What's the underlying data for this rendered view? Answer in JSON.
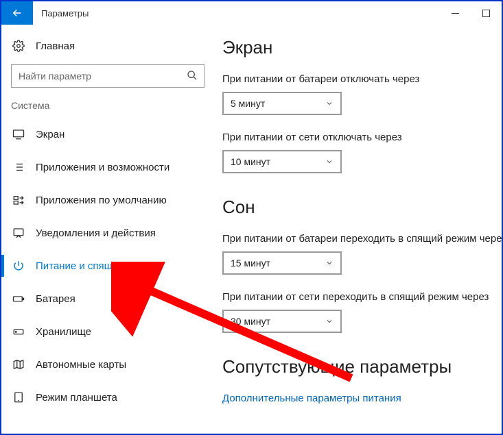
{
  "titlebar": {
    "title": "Параметры"
  },
  "sidebar": {
    "home": "Главная",
    "search_placeholder": "Найти параметр",
    "category": "Система",
    "items": [
      {
        "label": "Экран"
      },
      {
        "label": "Приложения и возможности"
      },
      {
        "label": "Приложения по умолчанию"
      },
      {
        "label": "Уведомления и действия"
      },
      {
        "label": "Питание и спящий режим"
      },
      {
        "label": "Батарея"
      },
      {
        "label": "Хранилище"
      },
      {
        "label": "Автономные карты"
      },
      {
        "label": "Режим планшета"
      }
    ]
  },
  "main": {
    "h1": "Экран",
    "battery_off_label": "При питании от батареи отключать через",
    "battery_off_value": "5 минут",
    "plugged_off_label": "При питании от сети отключать через",
    "plugged_off_value": "10 минут",
    "h2_sleep": "Сон",
    "battery_sleep_label": "При питании от батареи переходить в спящий режим через",
    "battery_sleep_value": "15 минут",
    "plugged_sleep_label": "При питании от сети переходить в спящий режим через",
    "plugged_sleep_value": "30 минут",
    "h2_related": "Сопутствующие параметры",
    "related_link": "Дополнительные параметры питания"
  }
}
